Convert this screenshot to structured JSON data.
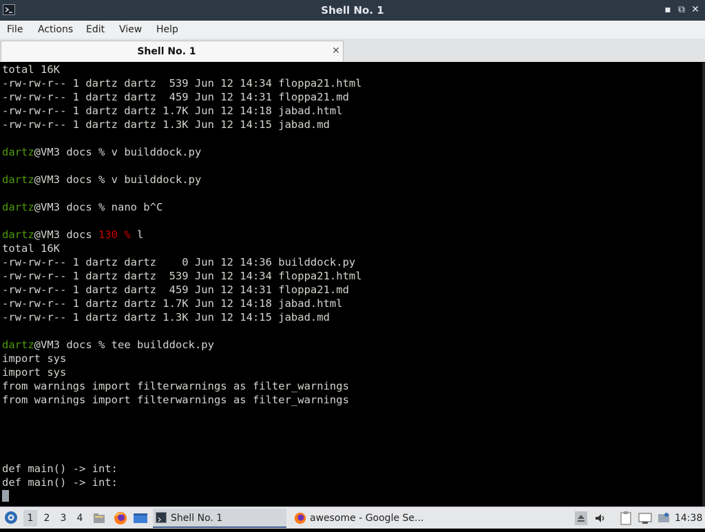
{
  "window": {
    "title": "Shell No. 1",
    "minimize_glyph": "▪",
    "restore_glyph": "⧉",
    "close_glyph": "✕"
  },
  "menu": [
    "File",
    "Actions",
    "Edit",
    "View",
    "Help"
  ],
  "tab": {
    "label": "Shell No. 1",
    "close_glyph": "✕"
  },
  "terminal": {
    "lines": [
      [
        {
          "t": "total 16K"
        }
      ],
      [
        {
          "t": "-rw-rw-r-- 1 dartz dartz  539 Jun 12 14:34 floppa21.html"
        }
      ],
      [
        {
          "t": "-rw-rw-r-- 1 dartz dartz  459 Jun 12 14:31 floppa21.md"
        }
      ],
      [
        {
          "t": "-rw-rw-r-- 1 dartz dartz 1.7K Jun 12 14:18 jabad.html"
        }
      ],
      [
        {
          "t": "-rw-rw-r-- 1 dartz dartz 1.3K Jun 12 14:15 jabad.md"
        }
      ],
      [],
      [
        {
          "t": "dartz",
          "c": "user"
        },
        {
          "t": "@VM3 docs % v builddock.py"
        }
      ],
      [],
      [
        {
          "t": "dartz",
          "c": "user"
        },
        {
          "t": "@VM3 docs % v builddock.py"
        }
      ],
      [],
      [
        {
          "t": "dartz",
          "c": "user"
        },
        {
          "t": "@VM3 docs % nano b^C"
        }
      ],
      [],
      [
        {
          "t": "dartz",
          "c": "user"
        },
        {
          "t": "@VM3 docs "
        },
        {
          "t": "130 %",
          "c": "err"
        },
        {
          "t": " l"
        }
      ],
      [
        {
          "t": "total 16K"
        }
      ],
      [
        {
          "t": "-rw-rw-r-- 1 dartz dartz    0 Jun 12 14:36 builddock.py"
        }
      ],
      [
        {
          "t": "-rw-rw-r-- 1 dartz dartz  539 Jun 12 14:34 floppa21.html"
        }
      ],
      [
        {
          "t": "-rw-rw-r-- 1 dartz dartz  459 Jun 12 14:31 floppa21.md"
        }
      ],
      [
        {
          "t": "-rw-rw-r-- 1 dartz dartz 1.7K Jun 12 14:18 jabad.html"
        }
      ],
      [
        {
          "t": "-rw-rw-r-- 1 dartz dartz 1.3K Jun 12 14:15 jabad.md"
        }
      ],
      [],
      [
        {
          "t": "dartz",
          "c": "user"
        },
        {
          "t": "@VM3 docs % tee builddock.py"
        }
      ],
      [
        {
          "t": "import sys"
        }
      ],
      [
        {
          "t": "import sys"
        }
      ],
      [
        {
          "t": "from warnings import filterwarnings as filter_warnings"
        }
      ],
      [
        {
          "t": "from warnings import filterwarnings as filter_warnings"
        }
      ],
      [],
      [],
      [],
      [],
      [
        {
          "t": "def main() -> int:"
        }
      ],
      [
        {
          "t": "def main() -> int:"
        }
      ],
      [
        {
          "cursor": true
        }
      ]
    ]
  },
  "taskbar": {
    "workspaces": [
      "1",
      "2",
      "3",
      "4"
    ],
    "tasks": [
      "Shell No. 1",
      "awesome - Google Se..."
    ],
    "clock": "14:38"
  },
  "colors": {
    "prompt_user": "#4e9a06",
    "error_status": "#cc0000",
    "terminal_bg": "#000000",
    "titlebar_bg": "#2d3845"
  },
  "icons": [
    "terminal-icon",
    "start-menu-icon",
    "file-manager-icon",
    "firefox-icon",
    "desktop-icon",
    "eject-icon",
    "volume-icon",
    "clipboard-icon",
    "network-icon",
    "notification-icon"
  ]
}
